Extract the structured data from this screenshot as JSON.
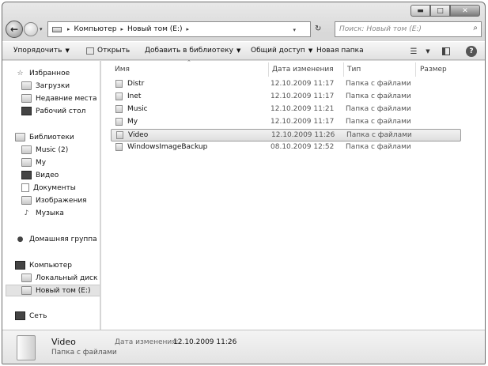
{
  "window": {
    "minimize_glyph": "▬",
    "maximize_glyph": "□",
    "close_glyph": "✕"
  },
  "nav": {
    "back_glyph": "←",
    "recent_glyph": "▾",
    "breadcrumbs": [
      "Компьютер",
      "Новый том (E:)"
    ],
    "breadcrumb_sep": "▸",
    "refresh_glyph": "↻",
    "search_placeholder": "Поиск: Новый том (E:)",
    "search_icon": "magnifier-icon"
  },
  "toolbar": {
    "organize": "Упорядочить",
    "open": "Открыть",
    "add_to_library": "Добавить в библиотеку",
    "share": "Общий доступ",
    "new_folder": "Новая папка",
    "caret": "▼",
    "help": "?"
  },
  "sidebar": {
    "favorites": "Избранное",
    "downloads": "Загрузки",
    "recent_places": "Недавние места",
    "desktop": "Рабочий стол",
    "libraries": "Библиотеки",
    "music2": "Music (2)",
    "my": "My",
    "video": "Видео",
    "documents": "Документы",
    "images": "Изображения",
    "music": "Музыка",
    "homegroup": "Домашняя группа",
    "computer": "Компьютер",
    "local_disk": "Локальный диск (C",
    "new_volume": "Новый том (E:)",
    "network": "Сеть"
  },
  "columns": {
    "name": "Имя",
    "date": "Дата изменения",
    "type": "Тип",
    "size": "Размер"
  },
  "files": [
    {
      "name": "Distr",
      "date": "12.10.2009 11:17",
      "type": "Папка с файлами"
    },
    {
      "name": "Inet",
      "date": "12.10.2009 11:17",
      "type": "Папка с файлами"
    },
    {
      "name": "Music",
      "date": "12.10.2009 11:21",
      "type": "Папка с файлами"
    },
    {
      "name": "My",
      "date": "12.10.2009 11:17",
      "type": "Папка с файлами"
    },
    {
      "name": "Video",
      "date": "12.10.2009 11:26",
      "type": "Папка с файлами"
    },
    {
      "name": "WindowsImageBackup",
      "date": "08.10.2009 12:52",
      "type": "Папка с файлами"
    }
  ],
  "details": {
    "name": "Video",
    "type": "Папка с файлами",
    "date_label": "Дата изменения:",
    "date_value": "12.10.2009 11:26"
  }
}
